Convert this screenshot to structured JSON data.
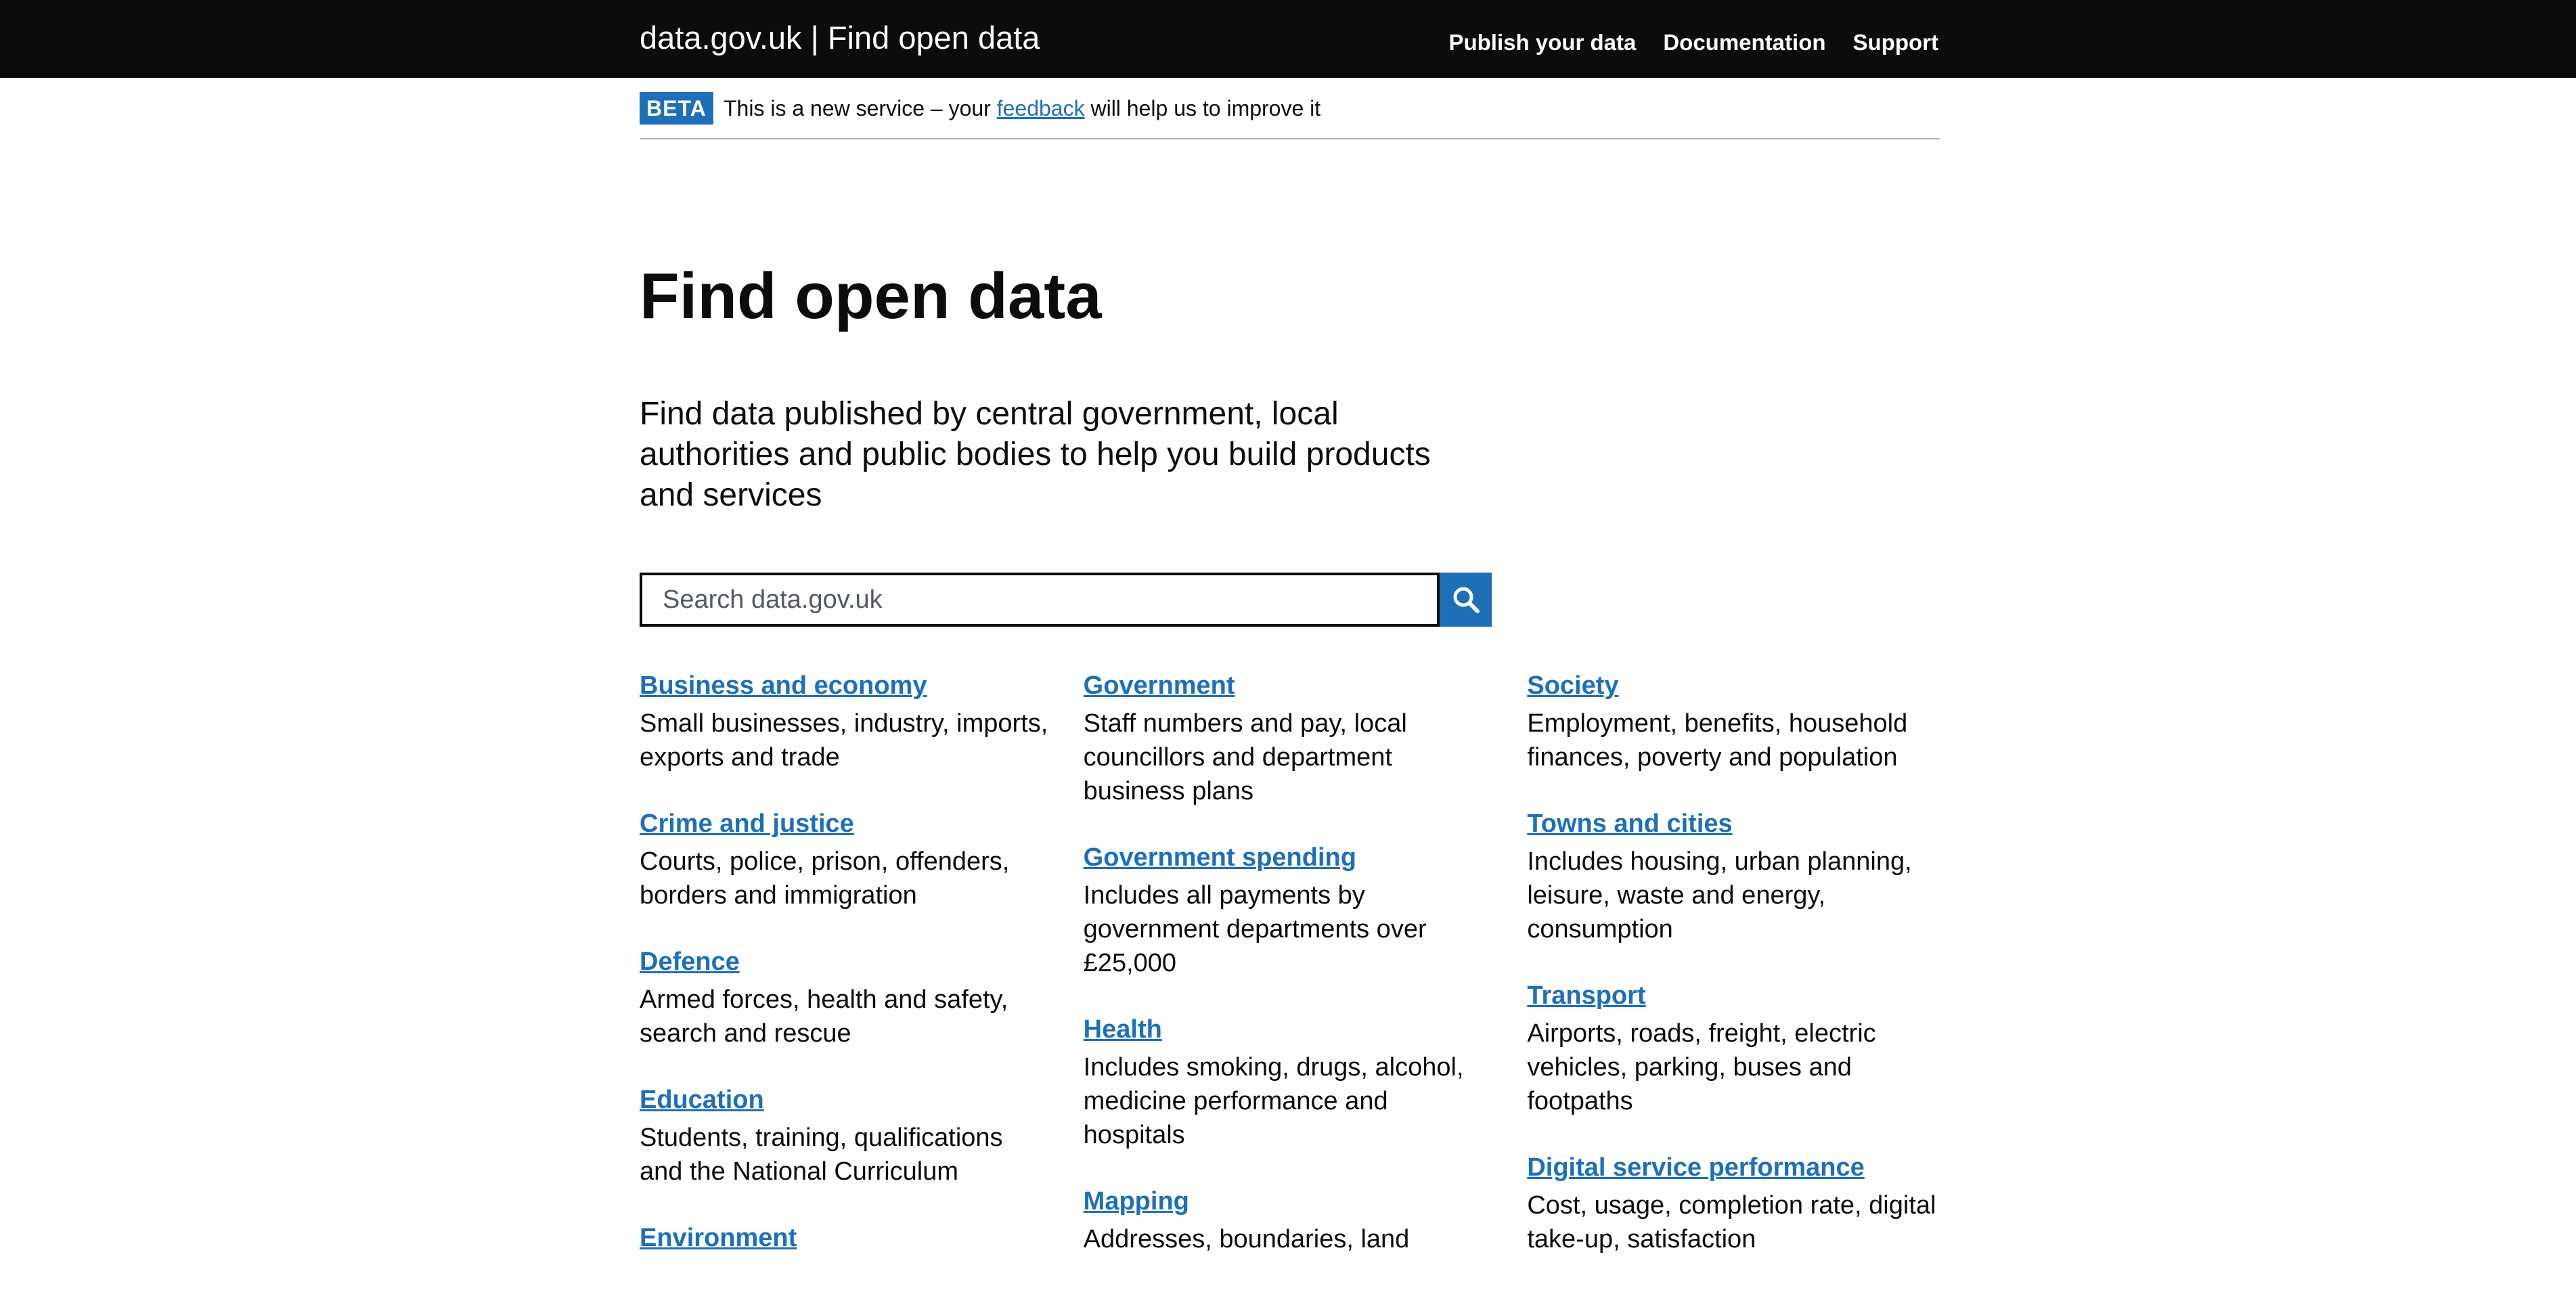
{
  "header": {
    "brand": "data.gov.uk | Find open data",
    "nav": [
      {
        "label": "Publish your data"
      },
      {
        "label": "Documentation"
      },
      {
        "label": "Support"
      }
    ]
  },
  "beta": {
    "tag": "BETA",
    "text_before": "This is a new service – your ",
    "link": "feedback",
    "text_after": " will help us to improve it"
  },
  "main": {
    "title": "Find open data",
    "lead": "Find data published by central government, local authorities and public bodies to help you build products and services",
    "search": {
      "placeholder": "Search data.gov.uk",
      "value": ""
    }
  },
  "topics": {
    "col1": [
      {
        "title": "Business and economy",
        "desc": "Small businesses, industry, imports, exports and trade"
      },
      {
        "title": "Crime and justice",
        "desc": "Courts, police, prison, offenders, borders and immigration"
      },
      {
        "title": "Defence",
        "desc": "Armed forces, health and safety, search and rescue"
      },
      {
        "title": "Education",
        "desc": "Students, training, qualifications and the National Curriculum"
      },
      {
        "title": "Environment",
        "desc": ""
      }
    ],
    "col2": [
      {
        "title": "Government",
        "desc": "Staff numbers and pay, local councillors and department business plans"
      },
      {
        "title": "Government spending",
        "desc": "Includes all payments by government departments over £25,000"
      },
      {
        "title": "Health",
        "desc": "Includes smoking, drugs, alcohol, medicine performance and hospitals"
      },
      {
        "title": "Mapping",
        "desc": "Addresses, boundaries, land"
      }
    ],
    "col3": [
      {
        "title": "Society",
        "desc": "Employment, benefits, household finances, poverty and population"
      },
      {
        "title": "Towns and cities",
        "desc": "Includes housing, urban planning, leisure, waste and energy, consumption"
      },
      {
        "title": "Transport",
        "desc": "Airports, roads, freight, electric vehicles, parking, buses and footpaths"
      },
      {
        "title": "Digital service performance",
        "desc": "Cost, usage, completion rate, digital take-up, satisfaction"
      }
    ]
  },
  "colors": {
    "header_bg": "#0b0c0c",
    "link": "#1d70b8",
    "beta_tag": "#1d70b8",
    "search_button": "#1d70b8",
    "text": "#0b0c0c"
  }
}
